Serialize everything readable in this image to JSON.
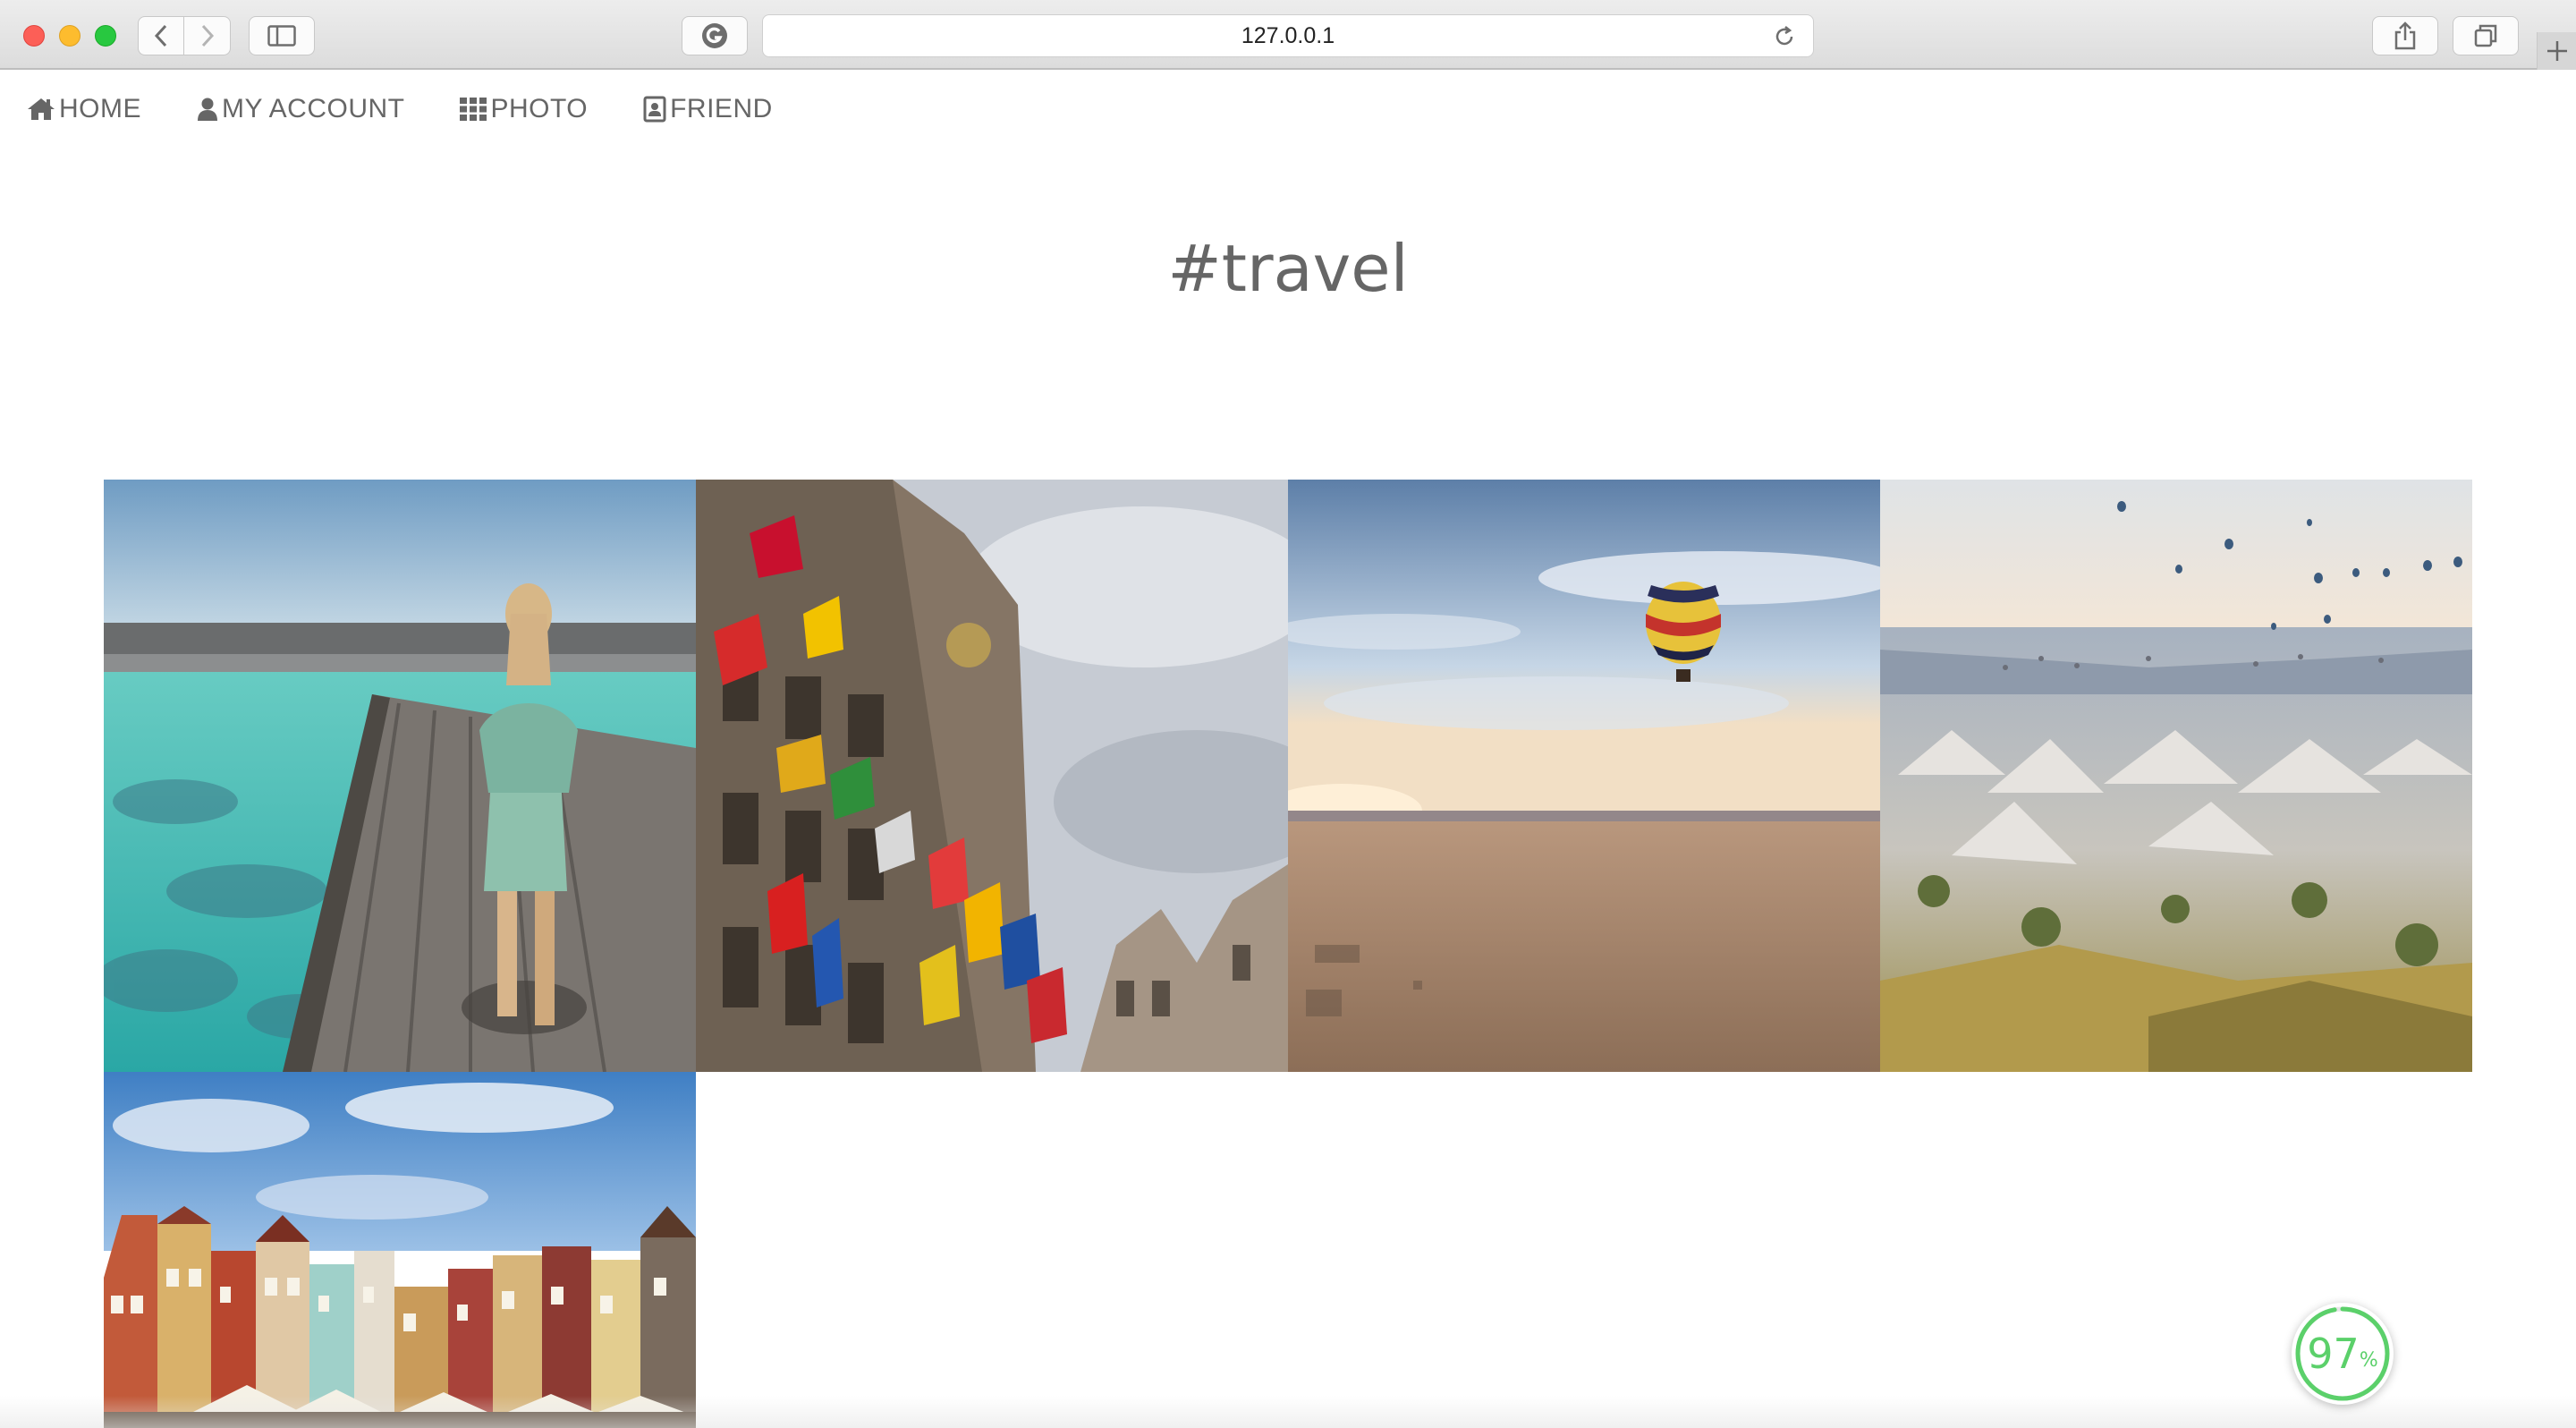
{
  "browser": {
    "url": "127.0.0.1"
  },
  "nav": {
    "items": [
      {
        "label": "HOME",
        "icon": "home-icon"
      },
      {
        "label": "MY ACCOUNT",
        "icon": "user-icon"
      },
      {
        "label": "PHOTO",
        "icon": "grid-icon"
      },
      {
        "label": "FRIEND",
        "icon": "contact-card-icon"
      }
    ]
  },
  "page": {
    "title": "#travel"
  },
  "photos": [
    {
      "subject": "woman walking on wooden pier over turquoise water"
    },
    {
      "subject": "ornate city hall facade with many flags"
    },
    {
      "subject": "hot air balloon over desert at sunrise"
    },
    {
      "subject": "hot air balloons over rocky valley landscape"
    },
    {
      "subject": "colorful old town market square buildings"
    }
  ],
  "progress": {
    "value": "97",
    "unit": "%",
    "color": "#5bd06a"
  }
}
